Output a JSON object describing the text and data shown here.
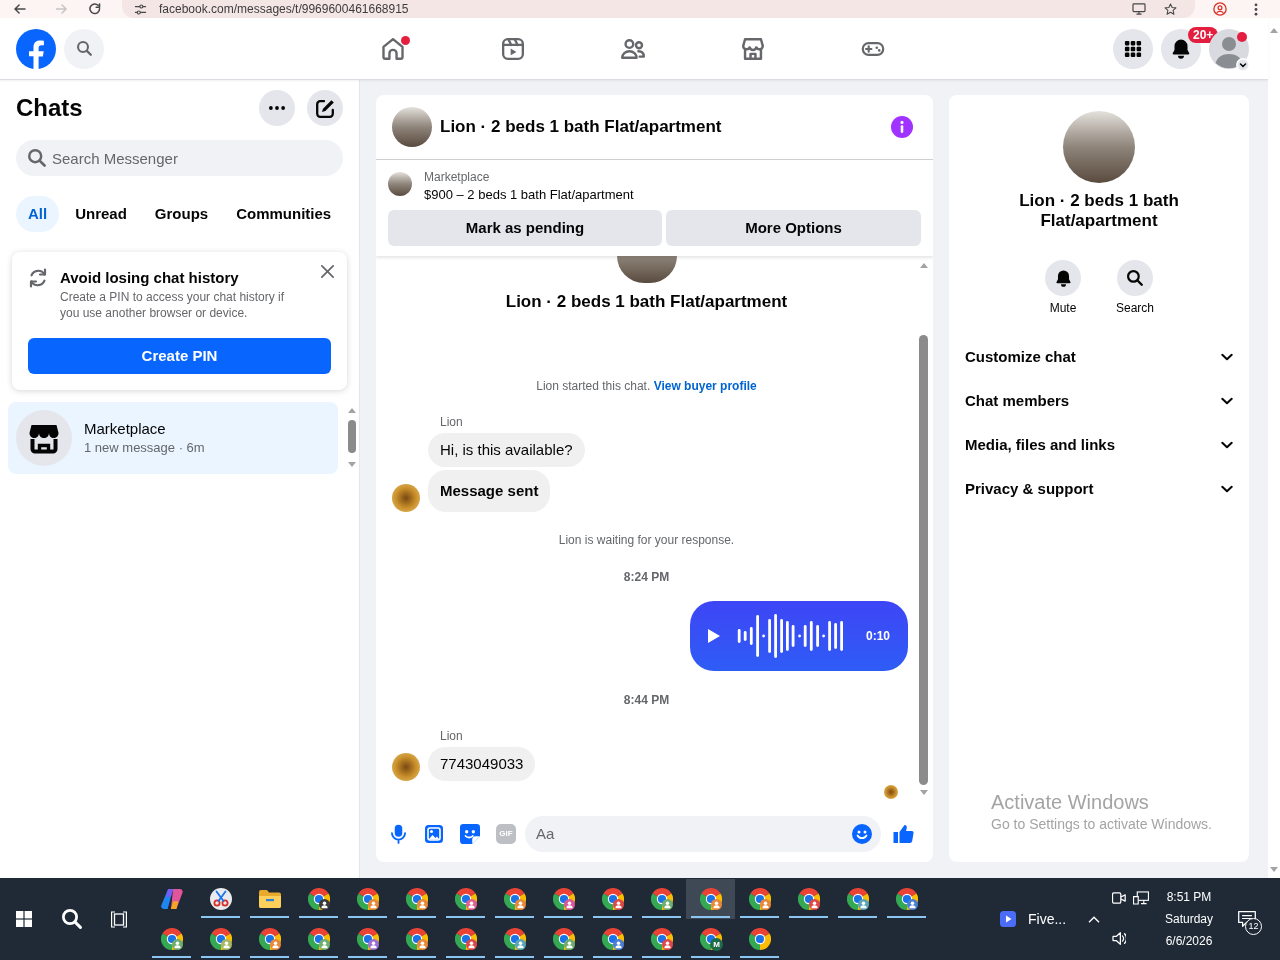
{
  "browser": {
    "url": "facebook.com/messages/t/9969600461668915"
  },
  "header": {
    "nav": [
      {
        "kind": "home",
        "selected": false,
        "notify": true
      },
      {
        "kind": "video",
        "selected": false,
        "notify": false
      },
      {
        "kind": "friends",
        "selected": false,
        "notify": false
      },
      {
        "kind": "marketplace",
        "selected": false,
        "notify": false
      },
      {
        "kind": "gaming",
        "selected": false,
        "notify": false
      }
    ],
    "actions": [
      {
        "kind": "menu"
      },
      {
        "kind": "notifications",
        "badge": "20+"
      },
      {
        "kind": "account",
        "notify": true
      }
    ]
  },
  "sidebar": {
    "title": "Chats",
    "search": {
      "placeholder": "Search Messenger"
    },
    "tabs": [
      {
        "label": "All",
        "selected": true
      },
      {
        "label": "Unread",
        "selected": false
      },
      {
        "label": "Groups",
        "selected": false
      },
      {
        "label": "Communities",
        "selected": false
      }
    ],
    "notice": {
      "title": "Avoid losing chat history",
      "text": "Create a PIN to access your chat history if you use another browser or device.",
      "button": "Create PIN"
    },
    "chats": [
      {
        "name": "Marketplace",
        "preview": "1 new message · 6m",
        "selected": true
      }
    ]
  },
  "chat": {
    "title": "Lion · 2 beds 1 bath Flat/apartment",
    "listing": {
      "source": "Marketplace",
      "summary": "$900 – 2 beds 1 bath Flat/apartment"
    },
    "actions": [
      "Mark as pending",
      "More Options"
    ],
    "intro_title": "Lion · 2 beds 1 bath Flat/apartment",
    "messages": [
      {
        "kind": "system",
        "text": "Lion started this chat.",
        "link": "View buyer profile"
      },
      {
        "kind": "incoming",
        "sender": "Lion",
        "bubbles": [
          {
            "text": "Hi, is this available?",
            "strong": false
          },
          {
            "text": "Message sent",
            "strong": true
          }
        ]
      },
      {
        "kind": "system",
        "text": "Lion is waiting for your response."
      },
      {
        "kind": "time",
        "text": "8:24 PM"
      },
      {
        "kind": "voice",
        "duration": "0:10"
      },
      {
        "kind": "time",
        "text": "8:44 PM"
      },
      {
        "kind": "incoming",
        "sender": "Lion",
        "bubbles": [
          {
            "text": "7743049033",
            "strong": false
          }
        ]
      }
    ],
    "read_receipt": true,
    "composer": {
      "gif_label": "GIF",
      "placeholder": "Aa"
    }
  },
  "details": {
    "title": "Lion · 2 beds 1 bath Flat/apartment",
    "actions": [
      {
        "kind": "mute",
        "label": "Mute"
      },
      {
        "kind": "search",
        "label": "Search"
      }
    ],
    "sections": [
      {
        "label": "Customize chat",
        "expanded": false
      },
      {
        "label": "Chat members",
        "expanded": false
      },
      {
        "label": "Media, files and links",
        "expanded": false
      },
      {
        "label": "Privacy & support",
        "expanded": false
      }
    ]
  },
  "activation_notice": {
    "title": "Activate Windows",
    "text": "Go to Settings to activate Windows."
  },
  "taskbar": {
    "apps": [
      {
        "kind": "copilot",
        "running": false,
        "selected": false
      },
      {
        "kind": "snip",
        "running": true,
        "selected": false
      },
      {
        "kind": "folder",
        "running": true,
        "selected": false
      },
      {
        "kind": "browser",
        "color": "#3a3a3a",
        "running": true,
        "selected": false
      },
      {
        "kind": "browser",
        "color": "#e8893a",
        "running": true,
        "selected": false
      },
      {
        "kind": "browser",
        "color": "#e8893a",
        "running": true,
        "selected": false
      },
      {
        "kind": "browser",
        "color": "#e0608f",
        "running": true,
        "selected": false
      },
      {
        "kind": "browser",
        "color": "#e8893a",
        "running": true,
        "selected": false
      },
      {
        "kind": "browser",
        "color": "#d9579a",
        "running": true,
        "selected": false
      },
      {
        "kind": "browser",
        "color": "#e04848",
        "running": true,
        "selected": false
      },
      {
        "kind": "browser",
        "color": "#6fae6f",
        "running": true,
        "selected": false
      },
      {
        "kind": "browser",
        "color": "#e8893a",
        "running": true,
        "selected": true
      },
      {
        "kind": "browser",
        "color": "#e8893a",
        "running": true,
        "selected": false
      },
      {
        "kind": "browser",
        "color": "#e04848",
        "running": true,
        "selected": false
      },
      {
        "kind": "browser",
        "color": "#5aa6b8",
        "running": true,
        "selected": false
      },
      {
        "kind": "browser",
        "color": "#4a7fd4",
        "running": true,
        "selected": false
      },
      {
        "kind": "browser",
        "color": "#6fae6f",
        "running": true,
        "selected": false
      },
      {
        "kind": "browser",
        "color": "#a6b866",
        "running": true,
        "selected": false
      },
      {
        "kind": "browser",
        "color": "#e8893a",
        "running": true,
        "selected": false
      },
      {
        "kind": "browser",
        "color": "#6fae6f",
        "running": true,
        "selected": false
      },
      {
        "kind": "browser",
        "color": "#9b6fd4",
        "running": true,
        "selected": false
      },
      {
        "kind": "browser",
        "color": "#e8893a",
        "running": true,
        "selected": false
      },
      {
        "kind": "browser",
        "color": "#e04848",
        "running": true,
        "selected": false
      },
      {
        "kind": "browser",
        "color": "#5aa6b8",
        "running": true,
        "selected": false
      },
      {
        "kind": "browser",
        "color": "#6fae6f",
        "running": true,
        "selected": false
      },
      {
        "kind": "browser",
        "color": "#4a7fd4",
        "running": true,
        "selected": false
      },
      {
        "kind": "browser",
        "color": "#e04848",
        "running": true,
        "selected": false
      },
      {
        "kind": "browser",
        "color": "#1e6b4a",
        "badge_text": "M",
        "running": true,
        "selected": false
      },
      {
        "kind": "browser",
        "running": true,
        "selected": false
      }
    ],
    "pinned": {
      "label": "Five..."
    },
    "clock": {
      "time": "8:51 PM",
      "day": "Saturday",
      "date": "6/6/2026"
    },
    "notification_count": "12"
  }
}
